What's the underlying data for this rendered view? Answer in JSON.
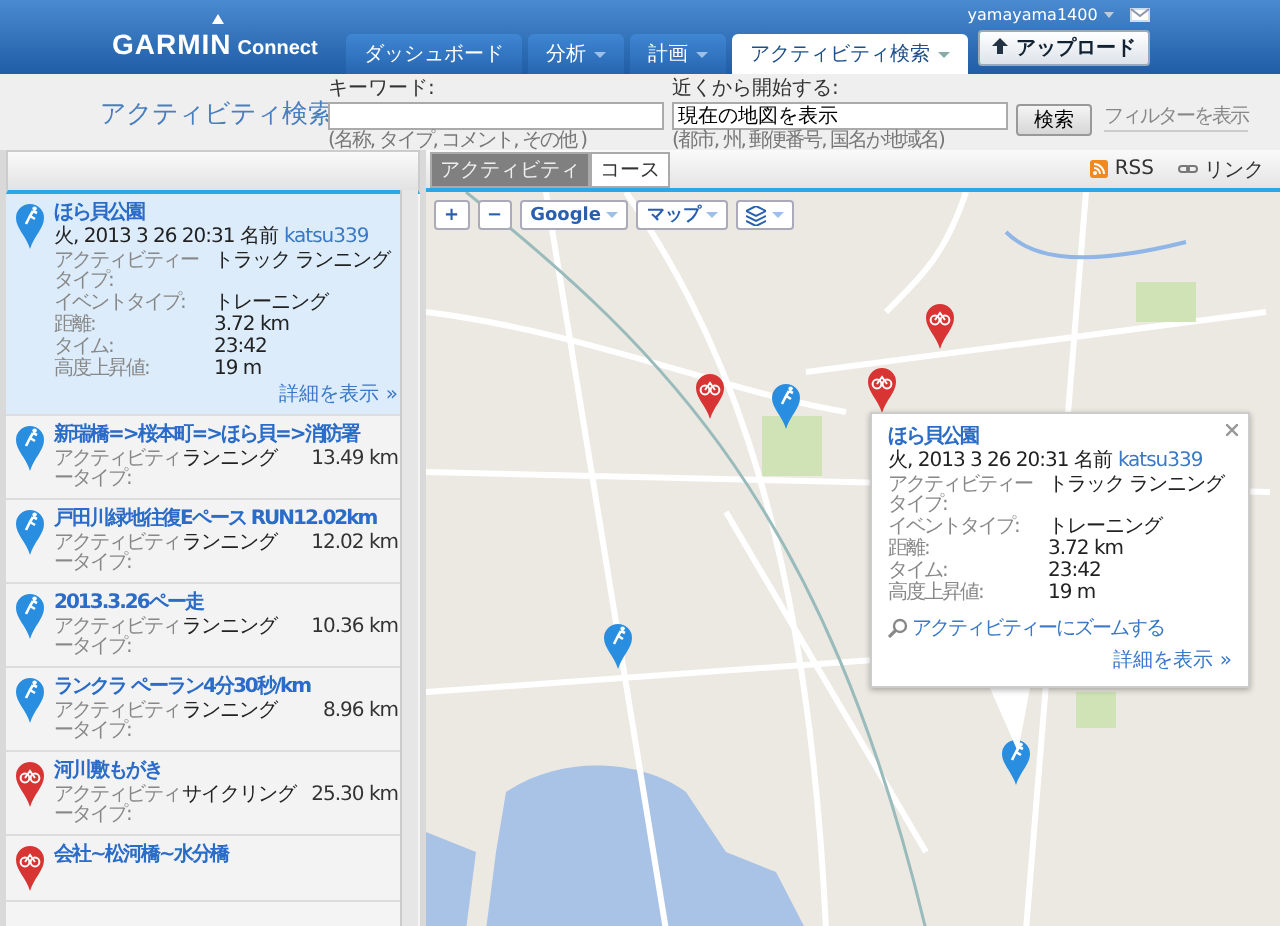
{
  "header": {
    "logo": "GARMIN",
    "logo_sub": "Connect",
    "user": "yamayama1400",
    "upload_button": "アップロード",
    "tabs": [
      {
        "label": "ダッシュボード",
        "dropdown": false,
        "selected": false
      },
      {
        "label": "分析",
        "dropdown": true,
        "selected": false
      },
      {
        "label": "計画",
        "dropdown": true,
        "selected": false
      },
      {
        "label": "アクティビティ検索",
        "dropdown": true,
        "selected": true
      }
    ]
  },
  "search": {
    "title": "アクティビティ検索",
    "keyword": {
      "label": "キーワード:",
      "hint": "(名称, タイプ, コメント, その他 )"
    },
    "near": {
      "label": "近くから開始する:",
      "value": "現在の地図を表示",
      "hint": "(都市, 州, 郵便番号, 国名か地域名)"
    },
    "search_button": "検索",
    "filter_link": "フィルターを表示"
  },
  "view_toggle": [
    {
      "label": "アクティビティ",
      "selected": true
    },
    {
      "label": "コース",
      "selected": false
    }
  ],
  "feed_links": [
    {
      "kind": "rss",
      "label": "RSS"
    },
    {
      "kind": "link",
      "label": "リンク"
    }
  ],
  "activities": [
    {
      "title": "ほら貝公園",
      "kind": "running",
      "selected": true,
      "date": "火, 2013 3 26 20:31 名前",
      "owner": "katsu339",
      "details": [
        {
          "label": "アクティビティータイプ:",
          "value": "トラック ランニング"
        },
        {
          "label": "イベントタイプ:",
          "value": "トレーニング"
        },
        {
          "label": "距離:",
          "value": "3.72 km"
        },
        {
          "label": "タイム:",
          "value": "23:42"
        },
        {
          "label": "高度上昇値:",
          "value": "19 m"
        }
      ],
      "more_link": "詳細を表示 »"
    },
    {
      "title": "新瑞橋=>桜本町=>ほら貝=>消防署",
      "kind": "running",
      "selected": false,
      "type_label": "アクティビティータイプ:",
      "type": "ランニング",
      "distance": "13.49 km"
    },
    {
      "title": "戸田川緑地往復Eペース RUN12.02km",
      "kind": "running",
      "selected": false,
      "type_label": "アクティビティータイプ:",
      "type": "ランニング",
      "distance": "12.02 km"
    },
    {
      "title": "2013.3.26ペー走",
      "kind": "running",
      "selected": false,
      "type_label": "アクティビティータイプ:",
      "type": "ランニング",
      "distance": "10.36 km"
    },
    {
      "title": "ランクラ ペーラン4分30秒/km",
      "kind": "running",
      "selected": false,
      "type_label": "アクティビティータイプ:",
      "type": "ランニング",
      "distance": "8.96 km"
    },
    {
      "title": "河川敷もがき",
      "kind": "cycling",
      "selected": false,
      "type_label": "アクティビティータイプ:",
      "type": "サイクリング",
      "distance": "25.30 km"
    },
    {
      "title": "会社~松河橋~水分橋",
      "kind": "cycling",
      "selected": false
    }
  ],
  "map": {
    "zoom_in": "+",
    "zoom_out": "−",
    "menus": [
      "Google",
      "マップ"
    ],
    "markers": [
      {
        "kind": "cycling"
      },
      {
        "kind": "running"
      },
      {
        "kind": "cycling"
      },
      {
        "kind": "cycling"
      },
      {
        "kind": "running"
      },
      {
        "kind": "running"
      }
    ],
    "popup": {
      "title": "ほら貝公園",
      "date": "火, 2013 3 26 20:31 名前",
      "owner": "katsu339",
      "details": [
        {
          "label": "アクティビティータイプ:",
          "value": "トラック ランニング"
        },
        {
          "label": "イベントタイプ:",
          "value": "トレーニング"
        },
        {
          "label": "距離:",
          "value": "3.72 km"
        },
        {
          "label": "タイム:",
          "value": "23:42"
        },
        {
          "label": "高度上昇値:",
          "value": "19 m"
        }
      ],
      "zoom_link": "アクティビティーにズームする",
      "more_link": "詳細を表示 »"
    }
  }
}
